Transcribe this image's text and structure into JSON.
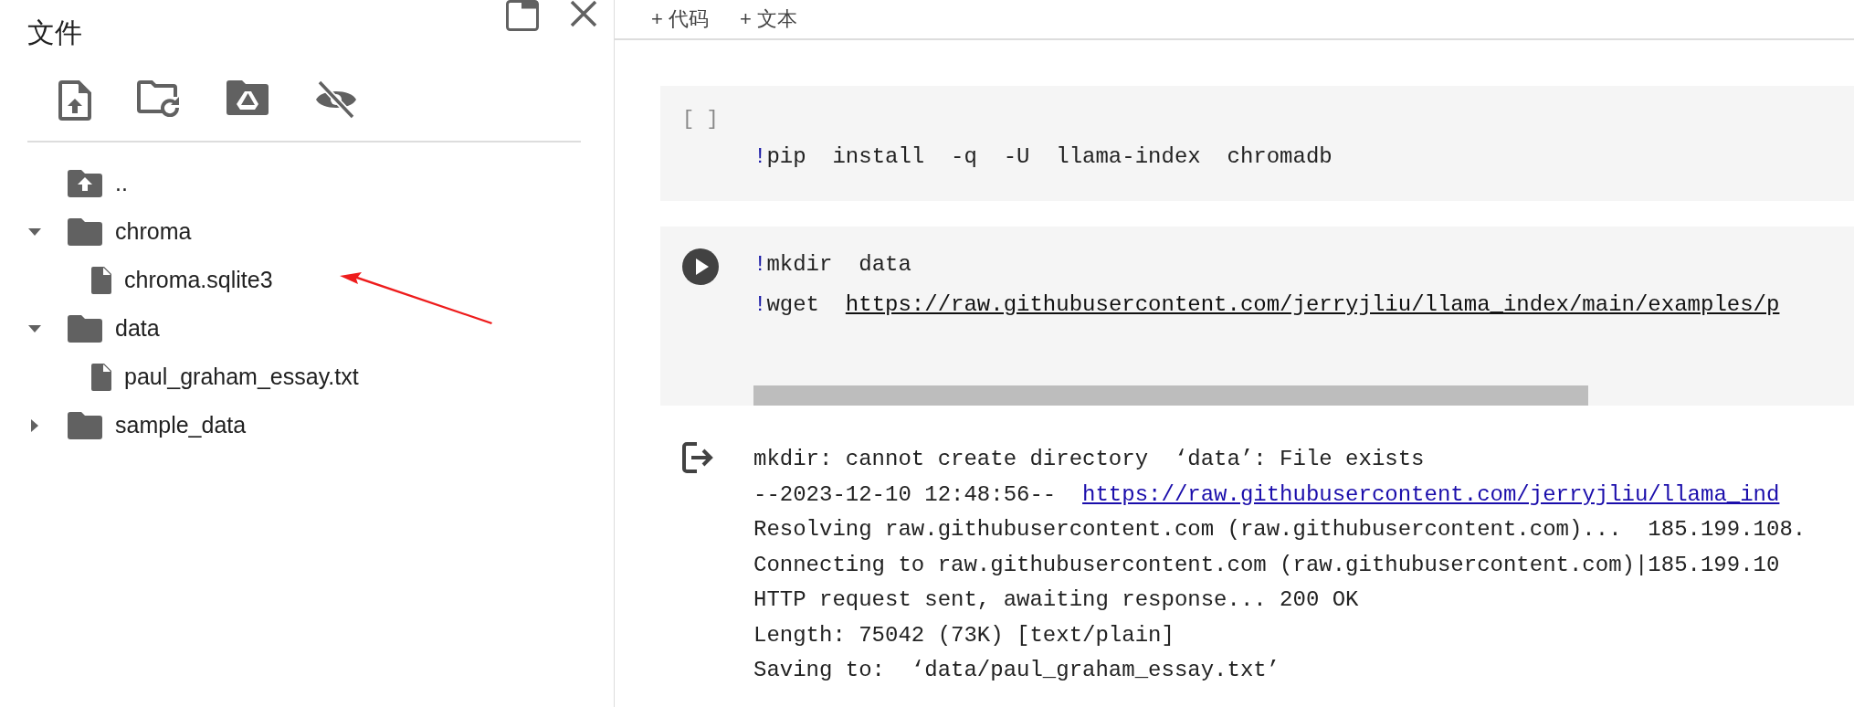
{
  "sidebar": {
    "title": "文件",
    "tree": [
      {
        "name": "..",
        "kind": "parent"
      },
      {
        "name": "chroma",
        "kind": "folder",
        "expanded": true,
        "children": [
          {
            "name": "chroma.sqlite3",
            "kind": "file"
          }
        ]
      },
      {
        "name": "data",
        "kind": "folder",
        "expanded": true,
        "children": [
          {
            "name": "paul_graham_essay.txt",
            "kind": "file"
          }
        ]
      },
      {
        "name": "sample_data",
        "kind": "folder",
        "expanded": false
      }
    ]
  },
  "toolbar": {
    "buttons": [
      "+ 代码",
      "+ 文本"
    ]
  },
  "cells": [
    {
      "prompt": "[ ]",
      "kind": "idle",
      "lines": [
        [
          {
            "text": "!",
            "kind": "magic"
          },
          {
            "text": "pip  install  -q  -U  llama-index  chromadb"
          }
        ]
      ]
    },
    {
      "kind": "run",
      "lines": [
        [
          {
            "text": "!",
            "kind": "magic"
          },
          {
            "text": "mkdir  data"
          }
        ],
        [
          {
            "text": "!",
            "kind": "magic"
          },
          {
            "text": "wget  "
          },
          {
            "text": "https://raw.githubusercontent.com/jerryjliu/llama_index/main/examples/p",
            "kind": "link"
          }
        ]
      ],
      "output": [
        [
          {
            "text": "mkdir: cannot create directory  ‘data’: File exists"
          }
        ],
        [
          {
            "text": "--2023-12-10 12:48:56--  "
          },
          {
            "text": "https://raw.githubusercontent.com/jerryjliu/llama_ind",
            "kind": "link"
          }
        ],
        [
          {
            "text": "Resolving raw.githubusercontent.com (raw.githubusercontent.com)...  185.199.108."
          }
        ],
        [
          {
            "text": "Connecting to raw.githubusercontent.com (raw.githubusercontent.com)|185.199.10"
          }
        ],
        [
          {
            "text": "HTTP request sent, awaiting response... 200 OK"
          }
        ],
        [
          {
            "text": "Length: 75042 (73K) [text/plain]"
          }
        ],
        [
          {
            "text": "Saving to:  ‘data/paul_graham_essay.txt’"
          }
        ]
      ]
    }
  ]
}
